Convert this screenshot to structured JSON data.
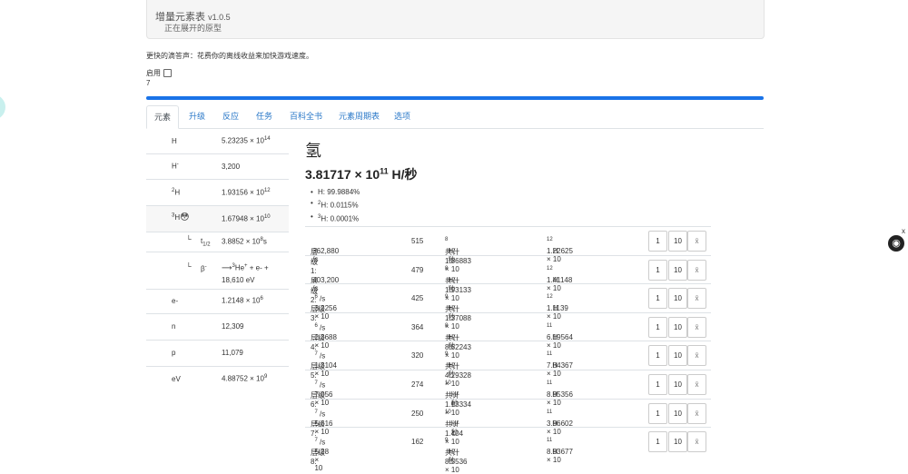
{
  "header": {
    "title": "增量元素表",
    "version": "v1.0.5",
    "subtitle": "正在展开的原型"
  },
  "tip": "更快的滴答声：花费你的离线收益来加快游戏速度。",
  "enable_label": "启用",
  "counter": "7",
  "progress_percent": 100,
  "tabs": [
    "元素",
    "升级",
    "反应",
    "任务",
    "百科全书",
    "元素周期表",
    "选项"
  ],
  "elements": {
    "H": {
      "sym": "H",
      "base": "5.23235 × 10",
      "exp": "14"
    },
    "H_minus": {
      "sym": "H",
      "sup": "-",
      "val": "3,200"
    },
    "H2": {
      "pre": "2",
      "sym": "H",
      "base": "1.93156 × 10",
      "exp": "12"
    },
    "H3": {
      "pre": "3",
      "sym": "H",
      "icon": "😳",
      "base": "1.67948 × 10",
      "exp": "10"
    },
    "half_life": {
      "label": "t",
      "sub": "1/2",
      "base": "3.8852 × 10",
      "exp": "8",
      "unit": "s"
    },
    "beta": {
      "label": "β",
      "sup": "-",
      "arrow": "⟶",
      "product_pre": "3",
      "product": "He",
      "product_sup": "+",
      "rest": " + e- +",
      "energy": "18,610 eV"
    },
    "e": {
      "sym": "e-",
      "base": "1.2148 × 10",
      "exp": "6"
    },
    "n": {
      "sym": "n",
      "val": "12,309"
    },
    "p": {
      "sym": "p",
      "val": "11,079"
    },
    "eV": {
      "sym": "eV",
      "base": "4.88752 × 10",
      "exp": "9"
    }
  },
  "detail": {
    "name": "氢",
    "rate_base": "3.81717 × 10",
    "rate_exp": "11",
    "rate_unit": " H/秒",
    "isotopes": [
      {
        "pre": "",
        "sym": "H",
        "pct": ": 99.9884%"
      },
      {
        "pre": "2",
        "sym": "H",
        "pct": ": 0.0115%"
      },
      {
        "pre": "3",
        "sym": "H",
        "pct": ": 0.0001%"
      }
    ]
  },
  "levels": [
    {
      "label": "层级 1:",
      "rate": "362,880 /s",
      "count": "515",
      "total_base": "共计 1.86883 × 10",
      "total_exp": "8",
      "total_unit": " H/秒",
      "cost_base": "1.22625 × 10",
      "cost_exp": "12",
      "cost_unit": " H"
    },
    {
      "label": "层级 2:",
      "rate": "403,200 /s",
      "count": "479",
      "total_base": "共计 1.93133 × 10",
      "total_exp": "8",
      "total_unit": " H/秒",
      "cost_base": "1.41148 × 10",
      "cost_exp": "12",
      "cost_unit": " H"
    },
    {
      "label": "层级 3:",
      "rate_base": "3.2256 × 10",
      "rate_exp": "6",
      "count": "425",
      "total_base": "共计 1.37088 × 10",
      "total_exp": "9",
      "total_unit": " H/秒",
      "cost_base": "1.1139 × 10",
      "cost_exp": "12",
      "cost_unit": " H"
    },
    {
      "label": "层级 4:",
      "rate_base": "2.3688 × 10",
      "rate_exp": "6",
      "count": "364",
      "total_base": "共计 8.62243 × 10",
      "total_exp": "8",
      "total_unit": " H/秒",
      "cost_base": "6.19564 × 10",
      "cost_exp": "11",
      "cost_unit": " H"
    },
    {
      "label": "层级 5:",
      "rate_base": "1.3104 × 10",
      "rate_exp": "7",
      "count": "320",
      "total_base": "共计 4.19328 × 10",
      "total_exp": "9",
      "total_unit": " H/秒",
      "cost_base": "7.84367 × 10",
      "cost_exp": "11",
      "cost_unit": " H"
    },
    {
      "label": "层级 6:",
      "rate_base": "7.056 × 10",
      "rate_exp": "7",
      "count": "274",
      "total_base": "共计 1.93334 × 10",
      "total_exp": "10",
      "total_unit": " H/秒",
      "cost_base": "8.95356 × 10",
      "cost_exp": "11",
      "cost_unit": " H"
    },
    {
      "label": "层级 7:",
      "rate_base": "5.616 × 10",
      "rate_exp": "7",
      "count": "250",
      "total_base": "共计 1.404 × 10",
      "total_exp": "10",
      "total_unit": " H/秒",
      "cost_base": "3.96602 × 10",
      "cost_exp": "11",
      "cost_unit": " H"
    },
    {
      "label": "层级 8:",
      "rate_base": "5.28 × 10",
      "rate_exp": "7",
      "count": "162",
      "total_base": "共计 8.5536 × 10",
      "total_exp": "9",
      "total_unit": " H/秒",
      "cost_base": "8.93677 × 10",
      "cost_exp": "11",
      "cost_unit": " H"
    }
  ],
  "buttons": {
    "one": "1",
    "ten": "10",
    "max": "x̄"
  },
  "corner": {
    "close": "x",
    "icon": "github-icon"
  }
}
